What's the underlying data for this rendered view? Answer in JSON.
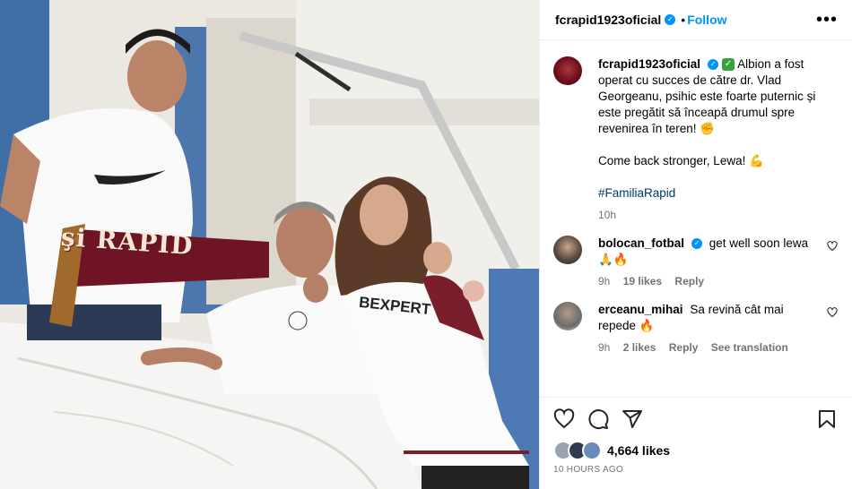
{
  "header": {
    "username": "fcrapid1923oficial",
    "separator": "•",
    "follow_label": "Follow",
    "more_label": "•••"
  },
  "photo": {
    "scarf_text": "şi RAPID",
    "shirt_text": "BEXPERT",
    "alt": "Photo of a player in a hospital bed with family holding a Rapid scarf"
  },
  "caption": {
    "username": "fcrapid1923oficial",
    "text_1": " Albion a fost operat cu succes de către dr. Vlad Georgeanu, psihic este foarte puternic și este pregătit să înceapă drumul spre revenirea în teren!",
    "text_2": "Come back stronger, Lewa!",
    "hashtag": "#FamiliaRapid",
    "time": "10h"
  },
  "comments": [
    {
      "username": "bolocan_fotbal",
      "text": "get well soon lewa",
      "time": "9h",
      "likes": "19 likes",
      "reply": "Reply"
    },
    {
      "username": "erceanu_mihai",
      "text": "Sa revină cât mai repede",
      "time": "9h",
      "likes": "2 likes",
      "reply": "Reply",
      "translate": "See translation"
    }
  ],
  "actions": {
    "likes_count": "4,664 likes",
    "timestamp": "10 HOURS AGO"
  },
  "icons": [
    "heart-icon",
    "comment-icon",
    "share-icon",
    "bookmark-icon",
    "more-icon",
    "verified-icon"
  ],
  "colors": {
    "accent": "#0095f6",
    "rapid_maroon": "#6b0d1a",
    "secondary_text": "#737373"
  }
}
